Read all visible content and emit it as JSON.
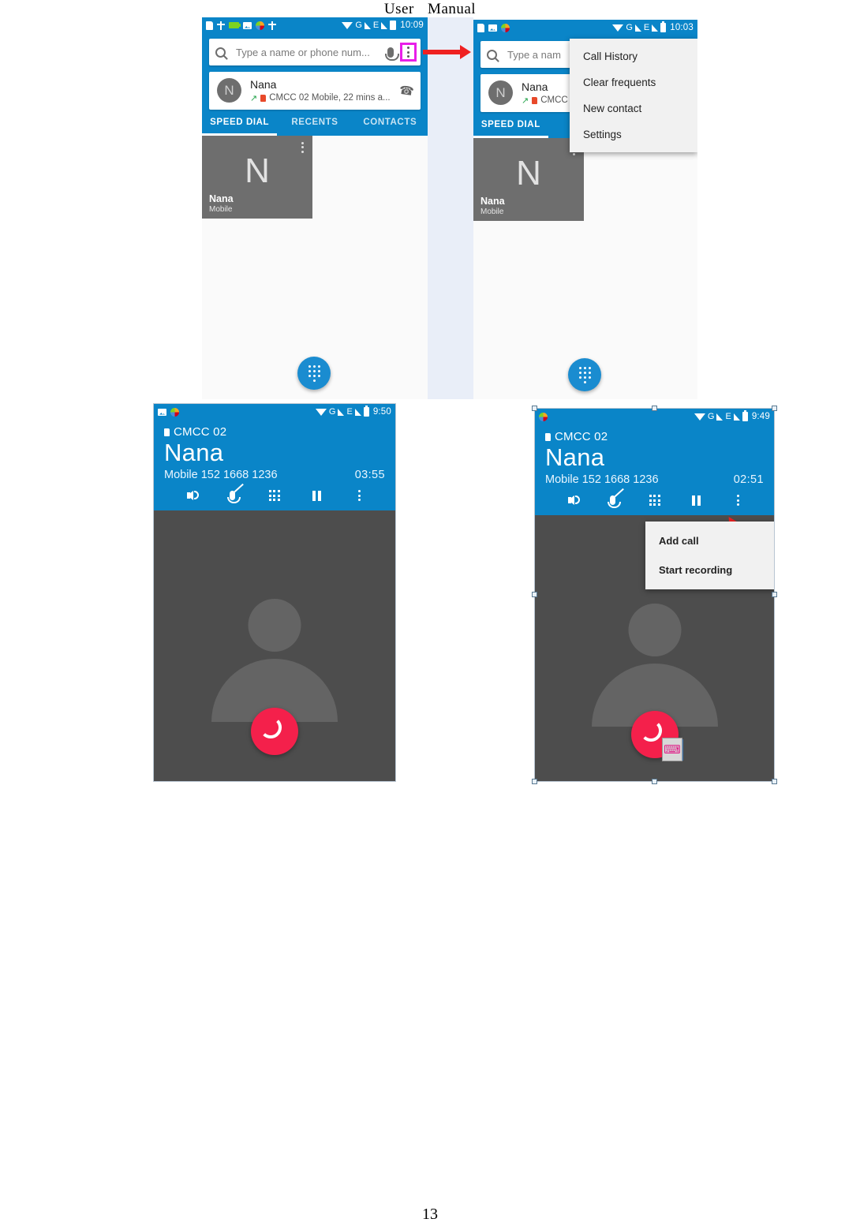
{
  "document": {
    "header_word1": "User",
    "header_word2": "Manual",
    "page_number": "13"
  },
  "shot1": {
    "name": "dialer-speed-dial-with-overflow-highlighted",
    "statusbar": {
      "left_icons": [
        "sd-card-icon",
        "usb-icon",
        "battery-charging-icon",
        "image-icon",
        "browser-icon",
        "usb-debug-icon"
      ],
      "wifi": "wifi-icon",
      "sim1_label": "G",
      "sim2_label": "E",
      "battery": "battery-icon",
      "time": "10:09"
    },
    "search": {
      "placeholder": "Type a name or phone num...",
      "mic": "mic-icon",
      "overflow": "overflow-menu-icon"
    },
    "contact": {
      "initial": "N",
      "name": "Nana",
      "detail": "CMCC 02 Mobile, 22 mins a...",
      "call_icon": "phone-icon"
    },
    "tabs": [
      {
        "label": "SPEED DIAL",
        "active": true
      },
      {
        "label": "RECENTS",
        "active": false
      },
      {
        "label": "CONTACTS",
        "active": false
      }
    ],
    "tile": {
      "initial": "N",
      "name": "Nana",
      "subtitle": "Mobile"
    },
    "fab": "dialpad-fab"
  },
  "shot2": {
    "name": "dialer-overflow-menu-open",
    "statusbar": {
      "left_icons": [
        "sd-card-icon",
        "image-icon",
        "browser-icon"
      ],
      "wifi": "wifi-icon",
      "sim1_label": "G",
      "sim2_label": "E",
      "battery": "battery-icon",
      "time": "10:03"
    },
    "search": {
      "placeholder": "Type a nam"
    },
    "contact": {
      "initial": "N",
      "name": "Nana",
      "detail": "CMCC "
    },
    "tabs": [
      {
        "label": "SPEED DIAL",
        "active": true
      },
      {
        "label": "R",
        "active": false
      }
    ],
    "menu": [
      "Call History",
      "Clear frequents",
      "New contact",
      "Settings"
    ],
    "tile": {
      "initial": "N",
      "name": "Nana",
      "subtitle": "Mobile"
    },
    "fab": "dialpad-fab"
  },
  "shot3": {
    "name": "in-call-screen",
    "statusbar": {
      "left_icons": [
        "image-icon",
        "browser-icon"
      ],
      "wifi": "wifi-icon",
      "sim1_label": "G",
      "sim2_label": "E",
      "battery": "battery-icon",
      "time": "9:50"
    },
    "sim": "CMCC 02",
    "caller": "Nana",
    "number": "Mobile 152 1668 1236",
    "duration": "03:55",
    "actions": [
      "speaker-icon",
      "mute-icon",
      "dialpad-icon",
      "hold-icon",
      "overflow-menu-icon"
    ],
    "end_call": "end-call-button"
  },
  "shot4": {
    "name": "in-call-screen-overflow-menu",
    "statusbar": {
      "left_icons": [
        "browser-icon"
      ],
      "wifi": "wifi-icon",
      "sim1_label": "G",
      "sim2_label": "E",
      "battery": "battery-icon",
      "time": "9:49"
    },
    "sim": "CMCC 02",
    "caller": "Nana",
    "number": "Mobile 152 1668 1236",
    "duration": "02:51",
    "actions": [
      "speaker-icon",
      "mute-icon",
      "dialpad-icon",
      "hold-icon",
      "overflow-menu-icon"
    ],
    "menu": [
      "Add call",
      "Start recording"
    ],
    "end_call": "end-call-button"
  },
  "annotations": {
    "arrow": "red-arrow-right",
    "highlight_color": "#e81ee8",
    "arrow_color": "#ef2121"
  }
}
